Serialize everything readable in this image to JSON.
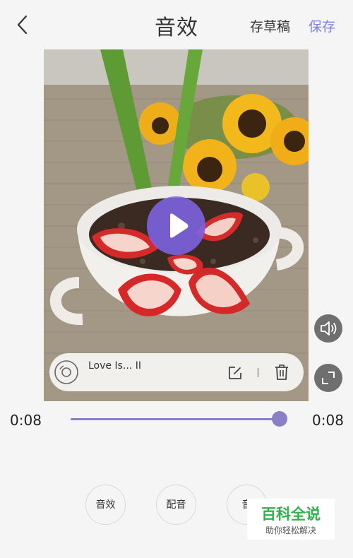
{
  "header": {
    "title": "音效",
    "draft_label": "存草稿",
    "save_label": "保存"
  },
  "music": {
    "title": "Love Is... II"
  },
  "player": {
    "current_time": "0:08",
    "total_time": "0:08",
    "progress": 1.0
  },
  "tools": [
    {
      "label": "音效"
    },
    {
      "label": "配音"
    },
    {
      "label": "音"
    }
  ],
  "watermark": {
    "title": "百科全说",
    "subtitle": "助你轻松解决"
  },
  "colors": {
    "accent": "#7d7fe6",
    "play_button": "#7e64e6",
    "slider": "#8a7fc7",
    "watermark_green": "#2fb24a"
  },
  "icons": [
    "back-icon",
    "play-icon",
    "music-disc-icon",
    "edit-icon",
    "trash-icon",
    "volume-icon",
    "fullscreen-icon"
  ]
}
